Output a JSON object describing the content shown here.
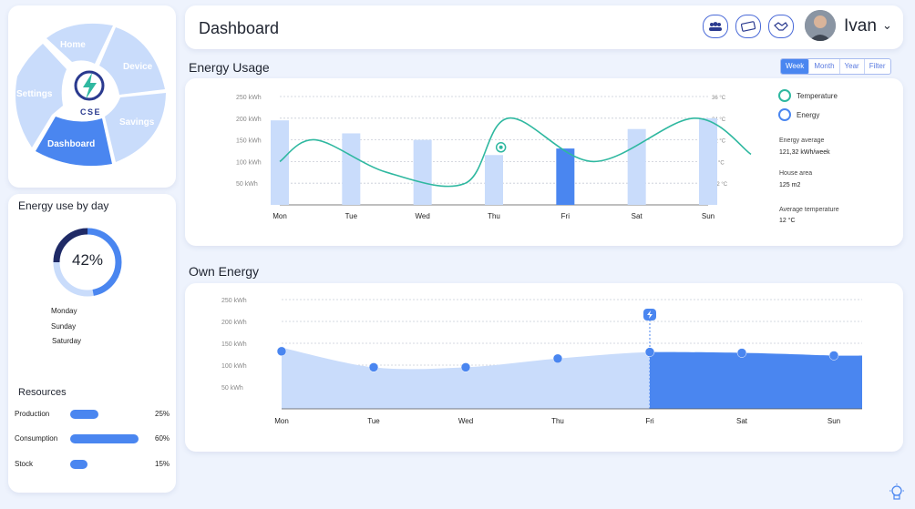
{
  "nav": {
    "logo_text": "CSE",
    "items": [
      {
        "label": "Home",
        "active": false
      },
      {
        "label": "Device",
        "active": false
      },
      {
        "label": "Savings",
        "active": false
      },
      {
        "label": "Dashboard",
        "active": true
      },
      {
        "label": "Settings",
        "active": false
      }
    ]
  },
  "header": {
    "title": "Dashboard",
    "icons": [
      "users-icon",
      "ticket-icon",
      "handshake-icon"
    ],
    "user_name": "Ivan",
    "chevron": "⌄"
  },
  "energy_usage": {
    "title": "Energy Usage",
    "filters": [
      "Week",
      "Month",
      "Year",
      "Filter"
    ],
    "active_filter": "Week",
    "legend": [
      {
        "label": "Temperature",
        "color": "#2fb8a0"
      },
      {
        "label": "Energy",
        "color": "#4a86f0"
      }
    ],
    "stats": [
      {
        "label": "Energy average",
        "value": "121,32 kWh/week"
      },
      {
        "label": "House area",
        "value": "125 m2"
      },
      {
        "label": "Average temperature",
        "value": "12 °C"
      }
    ]
  },
  "own_energy": {
    "title": "Own Energy"
  },
  "day_usage": {
    "title": "Energy use by day",
    "percent_label": "42%",
    "percent": 42,
    "days": [
      "Monday",
      "Sunday",
      "Saturday"
    ]
  },
  "resources": {
    "title": "Resources",
    "items": [
      {
        "label": "Production",
        "percent": 25,
        "percent_label": "25%"
      },
      {
        "label": "Consumption",
        "percent": 60,
        "percent_label": "60%"
      },
      {
        "label": "Stock",
        "percent": 15,
        "percent_label": "15%"
      }
    ]
  },
  "colors": {
    "accent": "#4a86f0",
    "light_accent": "#c9dcfb",
    "teal": "#2fb8a0"
  },
  "chart_data": [
    {
      "type": "bar",
      "title": "Energy Usage",
      "categories": [
        "Mon",
        "Tue",
        "Wed",
        "Thu",
        "Fri",
        "Sat",
        "Sun"
      ],
      "y_ticks": [
        "250 kWh",
        "200 kWh",
        "150 kWh",
        "100 kWh",
        "50 kWh"
      ],
      "y2_ticks": [
        "36 °C",
        "24 °C",
        "12 °C",
        "-0 °C",
        "-12 °C"
      ],
      "ylim": [
        0,
        250
      ],
      "y2lim": [
        -24,
        36
      ],
      "series": [
        {
          "name": "Energy",
          "values": [
            195,
            165,
            150,
            115,
            130,
            175,
            200
          ],
          "highlight_index": 4
        },
        {
          "name": "Temperature",
          "x": [
            0,
            0.5,
            1.5,
            2.6,
            3.2,
            4.4,
            5.8,
            6.6
          ],
          "values": [
            0,
            12,
            -6,
            -12,
            24,
            0,
            24,
            4
          ],
          "marker_x": 3.2
        }
      ],
      "grid": true
    },
    {
      "type": "area",
      "title": "Own Energy",
      "categories": [
        "Mon",
        "Tue",
        "Wed",
        "Thu",
        "Fri",
        "Sat",
        "Sun"
      ],
      "y_ticks": [
        "250 kWh",
        "200 kWh",
        "150 kWh",
        "100 kWh",
        "50 kWh"
      ],
      "ylim": [
        0,
        250
      ],
      "values": [
        140,
        95,
        95,
        115,
        130,
        128,
        122
      ],
      "highlight_from": 4,
      "grid": true
    }
  ]
}
